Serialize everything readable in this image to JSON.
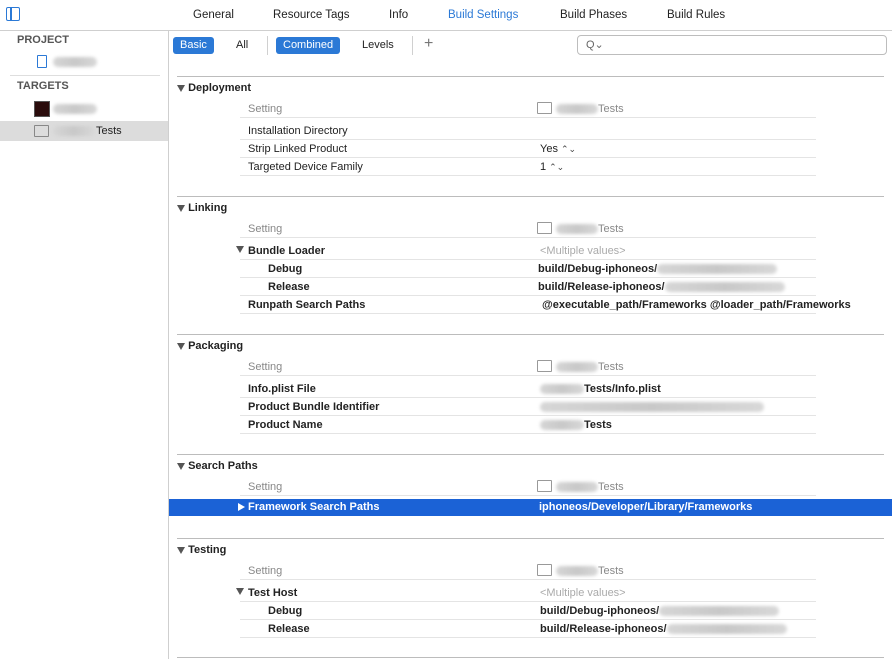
{
  "tabs": [
    "General",
    "Resource Tags",
    "Info",
    "Build Settings",
    "Build Phases",
    "Build Rules"
  ],
  "active_tab": "Build Settings",
  "sidebar": {
    "project_header": "PROJECT",
    "targets_header": "TARGETS",
    "target_tests_suffix": "Tests"
  },
  "filters": {
    "basic": "Basic",
    "all": "All",
    "combined": "Combined",
    "levels": "Levels",
    "add": "+"
  },
  "search": {
    "icon": "Q⌄",
    "placeholder": ""
  },
  "column": {
    "setting": "Setting",
    "target_suffix": "Tests"
  },
  "sections": {
    "deployment": {
      "title": "Deployment",
      "rows": [
        {
          "name": "Installation Directory",
          "value": ""
        },
        {
          "name": "Strip Linked Product",
          "value": "Yes"
        },
        {
          "name": "Targeted Device Family",
          "value": "1"
        }
      ]
    },
    "linking": {
      "title": "Linking",
      "bundle_loader": "Bundle Loader",
      "bundle_loader_value": "<Multiple values>",
      "debug": "Debug",
      "debug_value": "build/Debug-iphoneos/",
      "release": "Release",
      "release_value": "build/Release-iphoneos/",
      "runpath": "Runpath Search Paths",
      "runpath_value": "@executable_path/Frameworks @loader_path/Frameworks"
    },
    "packaging": {
      "title": "Packaging",
      "plist": "Info.plist File",
      "plist_value": "Tests/Info.plist",
      "bundle_id": "Product Bundle Identifier",
      "product_name": "Product Name",
      "product_name_value": "Tests"
    },
    "search_paths": {
      "title": "Search Paths",
      "framework": "Framework Search Paths",
      "framework_value": "iphoneos/Developer/Library/Frameworks"
    },
    "testing": {
      "title": "Testing",
      "test_host": "Test Host",
      "test_host_value": "<Multiple values>",
      "debug": "Debug",
      "debug_value": "build/Debug-iphoneos/",
      "release": "Release",
      "release_value": "build/Release-iphoneos/"
    }
  },
  "colors": {
    "accent": "#2b79d6",
    "selection": "#1b62d6"
  }
}
